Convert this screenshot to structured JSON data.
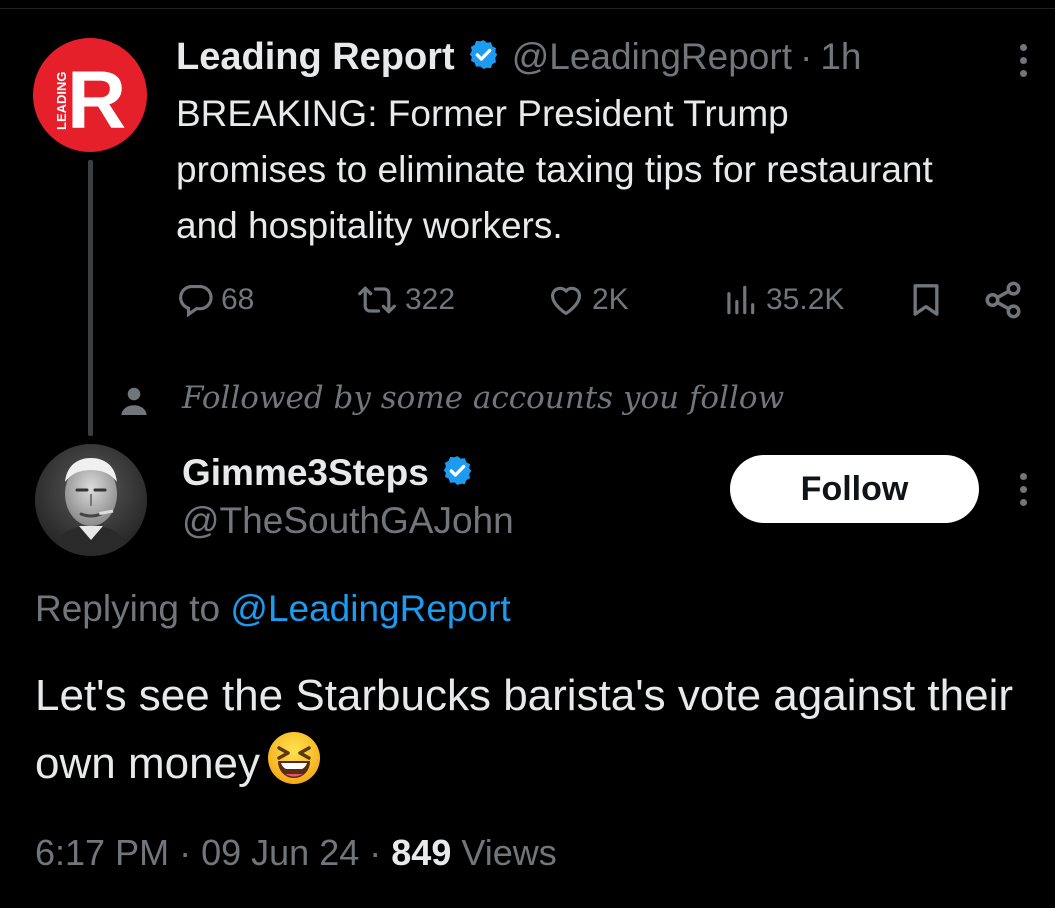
{
  "parent": {
    "author": {
      "name": "Leading Report",
      "handle": "@LeadingReport",
      "avatar_logo_text": "LEADING",
      "avatar_letter": "R"
    },
    "separator": "·",
    "time": "1h",
    "text": "BREAKING: Former President Trump promises to eliminate taxing tips for restaurant and hospitality workers.",
    "stats": {
      "replies": "68",
      "reposts": "322",
      "likes": "2K",
      "views": "35.2K"
    }
  },
  "social_context": "Followed by some accounts you follow",
  "reply": {
    "author": {
      "name": "Gimme3Steps",
      "handle": "@TheSouthGAJohn"
    },
    "follow_label": "Follow",
    "replying_prefix": "Replying to",
    "replying_mention": "@LeadingReport",
    "text": "Let's see the Starbucks barista's vote against their own money",
    "emoji": "laughing-face-emoji",
    "time": "6:17 PM",
    "separator": "·",
    "date": "09 Jun 24",
    "views_count": "849",
    "views_label": "Views"
  },
  "colors": {
    "background": "#000000",
    "text": "#e7e9ea",
    "muted": "#71767b",
    "accent": "#1d9bf0",
    "brand_red": "#e6202b"
  },
  "icons": {
    "verified": "verified-badge-icon",
    "reply": "reply-bubble-icon",
    "repost": "repost-icon",
    "like": "heart-icon",
    "views": "views-bar-icon",
    "bookmark": "bookmark-icon",
    "share": "share-icon",
    "more": "more-vertical-icon",
    "person": "person-icon"
  }
}
